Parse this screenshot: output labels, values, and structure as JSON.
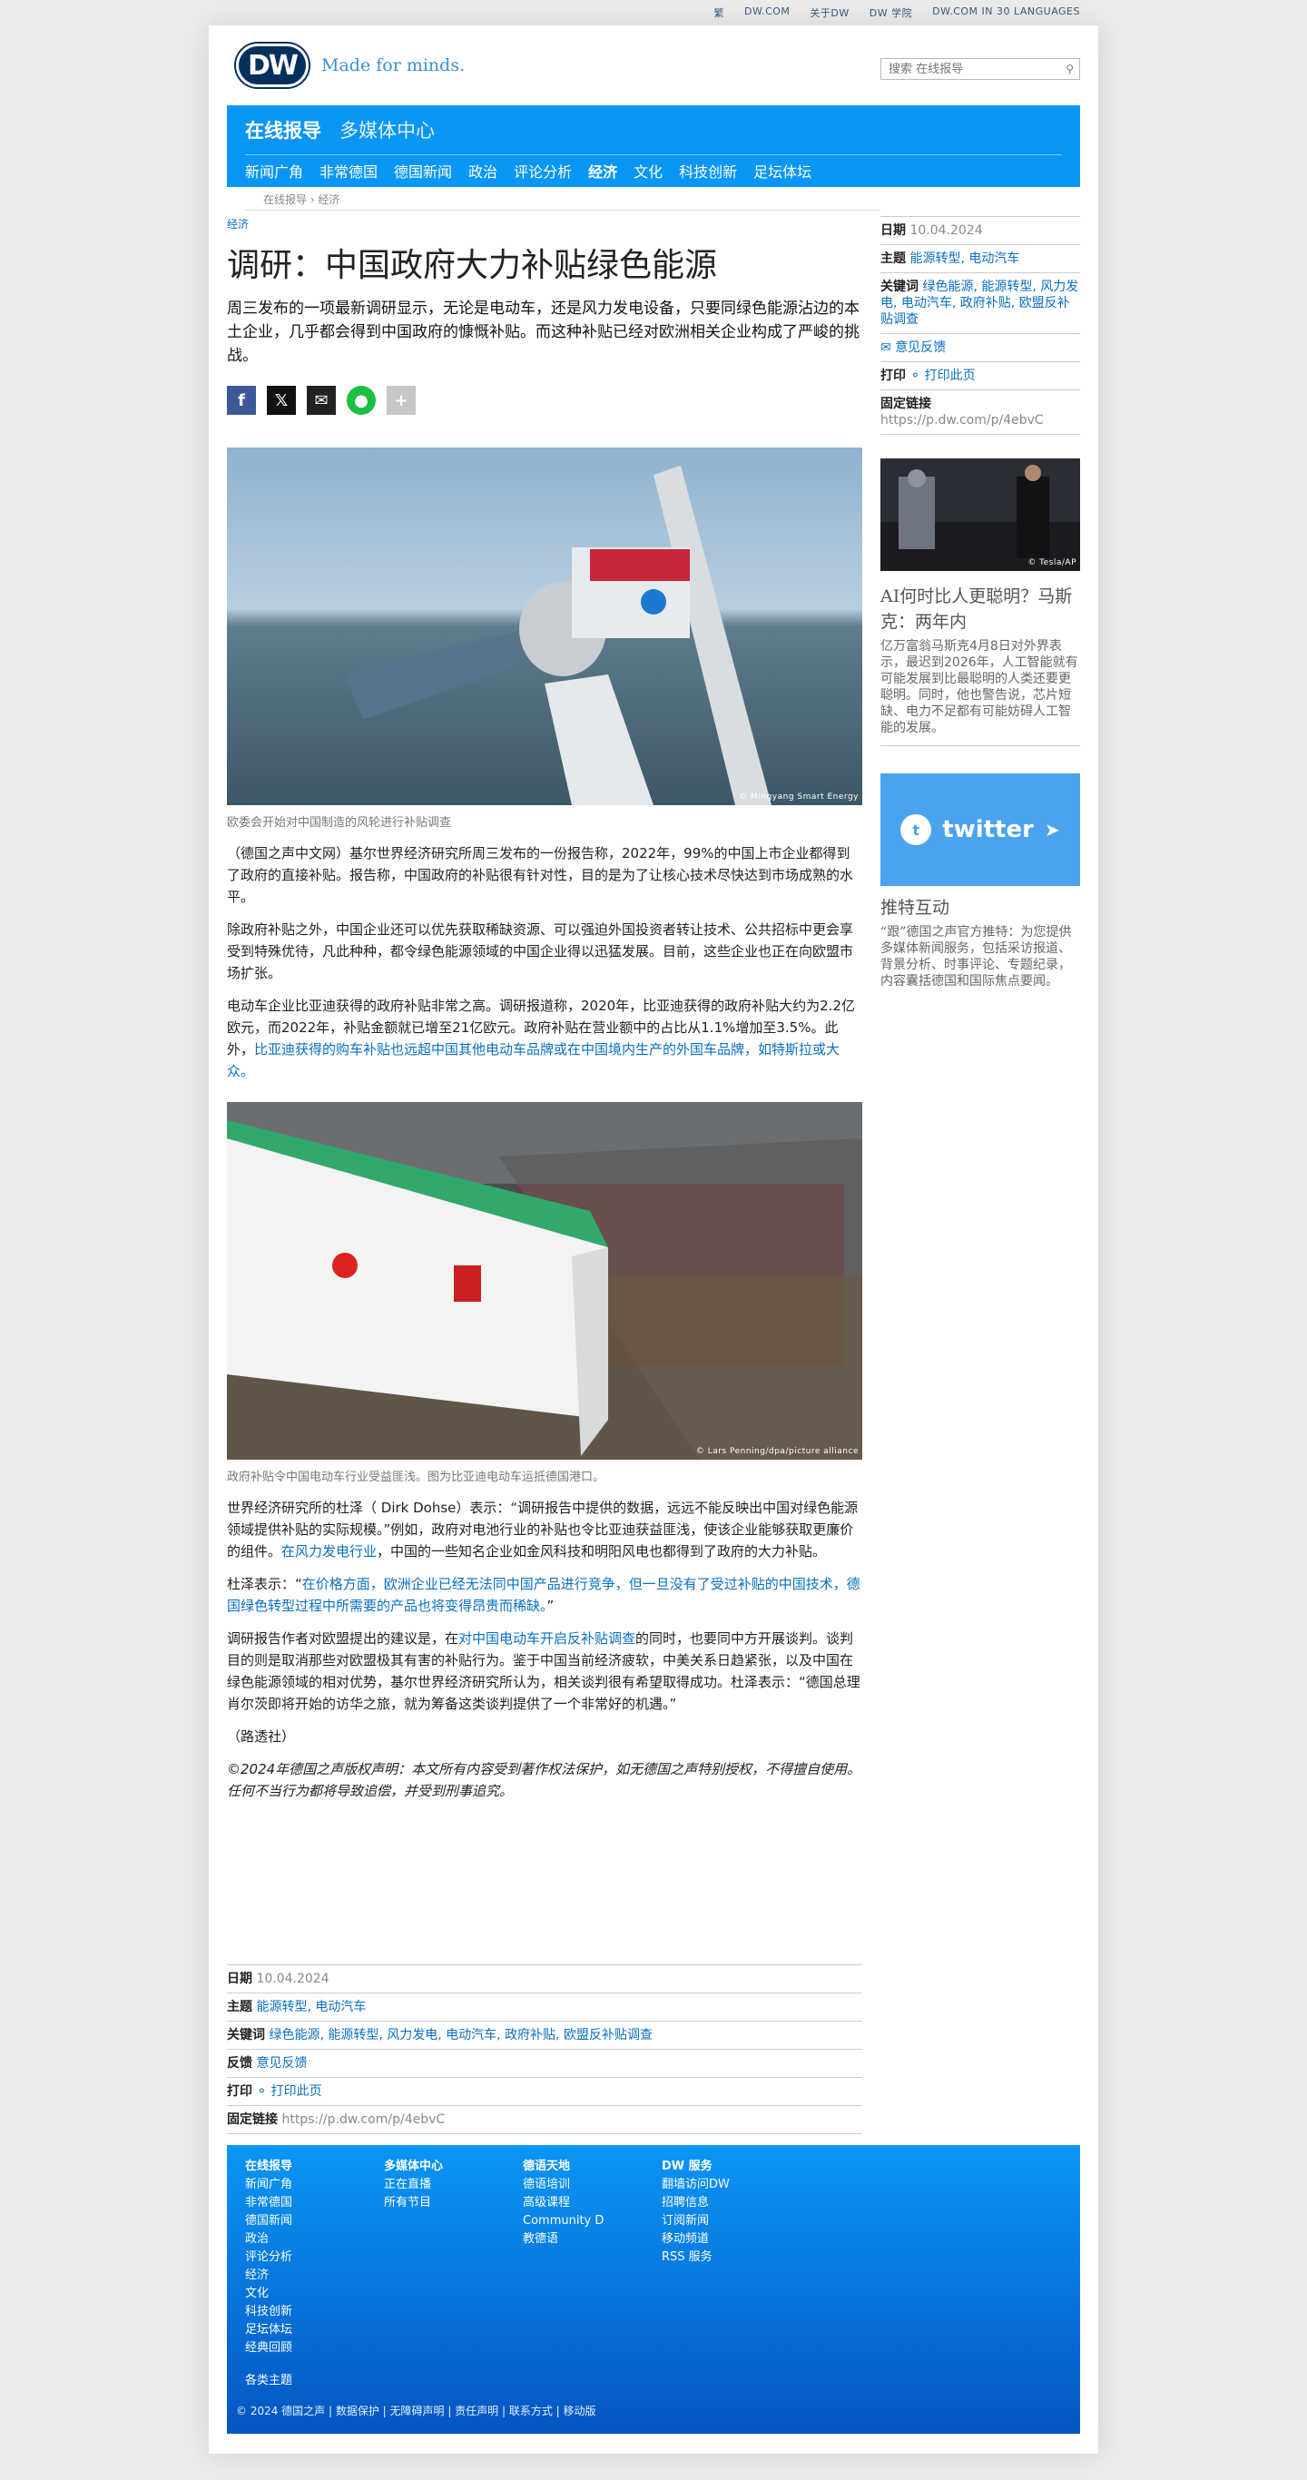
{
  "topbar": [
    "繁",
    "DW.COM",
    "关于DW",
    "DW 学院",
    "DW.COM IN 30 LANGUAGES"
  ],
  "logo": {
    "text": "DW",
    "tagline": "Made for minds."
  },
  "search": {
    "placeholder": "搜索 在线报导"
  },
  "nav": {
    "primary": "在线报导",
    "secondary": "多媒体中心",
    "items": [
      "新闻广角",
      "非常德国",
      "德国新闻",
      "政治",
      "评论分析",
      "经济",
      "文化",
      "科技创新",
      "足坛体坛"
    ],
    "active": "经济"
  },
  "breadcrumb": "在线报导 › 经济",
  "article": {
    "kicker": "经济",
    "title": "调研：中国政府大力补贴绿色能源",
    "lead": "周三发布的一项最新调研显示，无论是电动车，还是风力发电设备，只要同绿色能源沾边的本土企业，几乎都会得到中国政府的慷慨补贴。而这种补贴已经对欧洲相关企业构成了严峻的挑战。",
    "image1_credit": "© Mingyang Smart Energy",
    "caption1": "欧委会开始对中国制造的风轮进行补贴调查",
    "p1": "（德国之声中文网）基尔世界经济研究所周三发布的一份报告称，2022年，99%的中国上市企业都得到了政府的直接补贴。报告称，中国政府的补贴很有针对性，目的是为了让核心技术尽快达到市场成熟的水平。",
    "p2": "除政府补贴之外，中国企业还可以优先获取稀缺资源、可以强迫外国投资者转让技术、公共招标中更会享受到特殊优待，凡此种种，都令绿色能源领域的中国企业得以迅猛发展。目前，这些企业也正在向欧盟市场扩张。",
    "p3_text": "电动车企业比亚迪获得的政府补贴非常之高。调研报道称，2020年，比亚迪获得的政府补贴大约为2.2亿欧元，而2022年，补贴金额就已增至21亿欧元。政府补贴在营业额中的占比从1.1%增加至3.5%。此外，",
    "p3_link": "比亚迪获得的购车补贴也远超中国其他电动车品牌或在中国境内生产的外国车品牌，如特斯拉或大众。",
    "image2_credit": "© Lars Penning/dpa/picture alliance",
    "caption2": "政府补贴令中国电动车行业受益匪浅。图为比亚迪电动车运抵德国港口。",
    "p4_text": "世界经济研究所的杜泽（ Dirk Dohse）表示：“调研报告中提供的数据，远远不能反映出中国对绿色能源领域提供补贴的实际规模。”例如，政府对电池行业的补贴也令比亚迪获益匪浅，使该企业能够获取更廉价的组件。",
    "p4_link": "在风力发电行业",
    "p4_rest": "，中国的一些知名企业如金风科技和明阳风电也都得到了政府的大力补贴。",
    "p5_text": "杜泽表示：“",
    "p5_link": "在价格方面，欧洲企业已经无法同中国产品进行竞争，但一旦没有了受过补贴的中国技术，德国绿色转型过程中所需要的产品也将变得昂贵而稀缺。",
    "p5_end": "”",
    "p6_text": "调研报告作者对欧盟提出的建议是，在",
    "p6_link": "对中国电动车开启反补贴调查",
    "p6_rest": "的同时，也要同中方开展谈判。谈判目的则是取消那些对欧盟极其有害的补贴行为。鉴于中国当前经济疲软，中美关系日趋紧张，以及中国在绿色能源领域的相对优势，基尔世界经济研究所认为，相关谈判很有希望取得成功。杜泽表示：“德国总理肖尔茨即将开始的访华之旅，就为筹备这类谈判提供了一个非常好的机遇。”",
    "source": "（路透社）",
    "copyright": "©2024年德国之声版权声明：本文所有内容受到著作权法保护，如无德国之声特别授权，不得擅自使用。任何不当行为都将导致追偿，并受到刑事追究。"
  },
  "meta": {
    "date_label": "日期",
    "date": "10.04.2024",
    "topics_label": "主题",
    "topics": "能源转型, 电动汽车",
    "keywords_label": "关键词",
    "keywords": "绿色能源, 能源转型, 风力发电, 电动汽车, 政府补贴, 欧盟反补贴调查",
    "feedback_label": "反馈",
    "feedback": "意见反馈",
    "print_label": "打印",
    "print": "打印此页",
    "permalink_label": "固定链接",
    "permalink": "https://p.dw.com/p/4ebvC"
  },
  "sidebar": {
    "teaser_credit": "© Tesla/AP",
    "teaser_title": "AI何时比人更聪明？马斯克：两年内",
    "teaser_text": "亿万富翁马斯克4月8日对外界表示，最迟到2026年，人工智能就有可能发展到比最聪明的人类还要更聪明。同时，他也警告说，芯片短缺、电力不足都有可能妨碍人工智能的发展。",
    "twitter_word": "twitter",
    "twitter_title": "推特互动",
    "twitter_text": "“跟”德国之声官方推特：为您提供多媒体新闻服务，包括采访报道、背景分析、时事评论、专题纪录，内容囊括德国和国际焦点要闻。"
  },
  "footer": {
    "col1_head": "在线报导",
    "col1": [
      "新闻广角",
      "非常德国",
      "德国新闻",
      "政治",
      "评论分析",
      "经济",
      "文化",
      "科技创新",
      "足坛体坛",
      "经典回顾"
    ],
    "col1_extra": "各类主题",
    "col2_head": "多媒体中心",
    "col2": [
      "正在直播",
      "所有节目"
    ],
    "col3_head": "德语天地",
    "col3": [
      "德语培训",
      "高级课程",
      "Community D",
      "教德语"
    ],
    "col4_head": "DW 服务",
    "col4": [
      "翻墙访问DW",
      "招聘信息",
      "订阅新闻",
      "移动频道",
      "RSS 服务"
    ],
    "bottom": "© 2024 德国之声 | 数据保护 | 无障碍声明 | 责任声明 | 联系方式 | 移动版"
  }
}
